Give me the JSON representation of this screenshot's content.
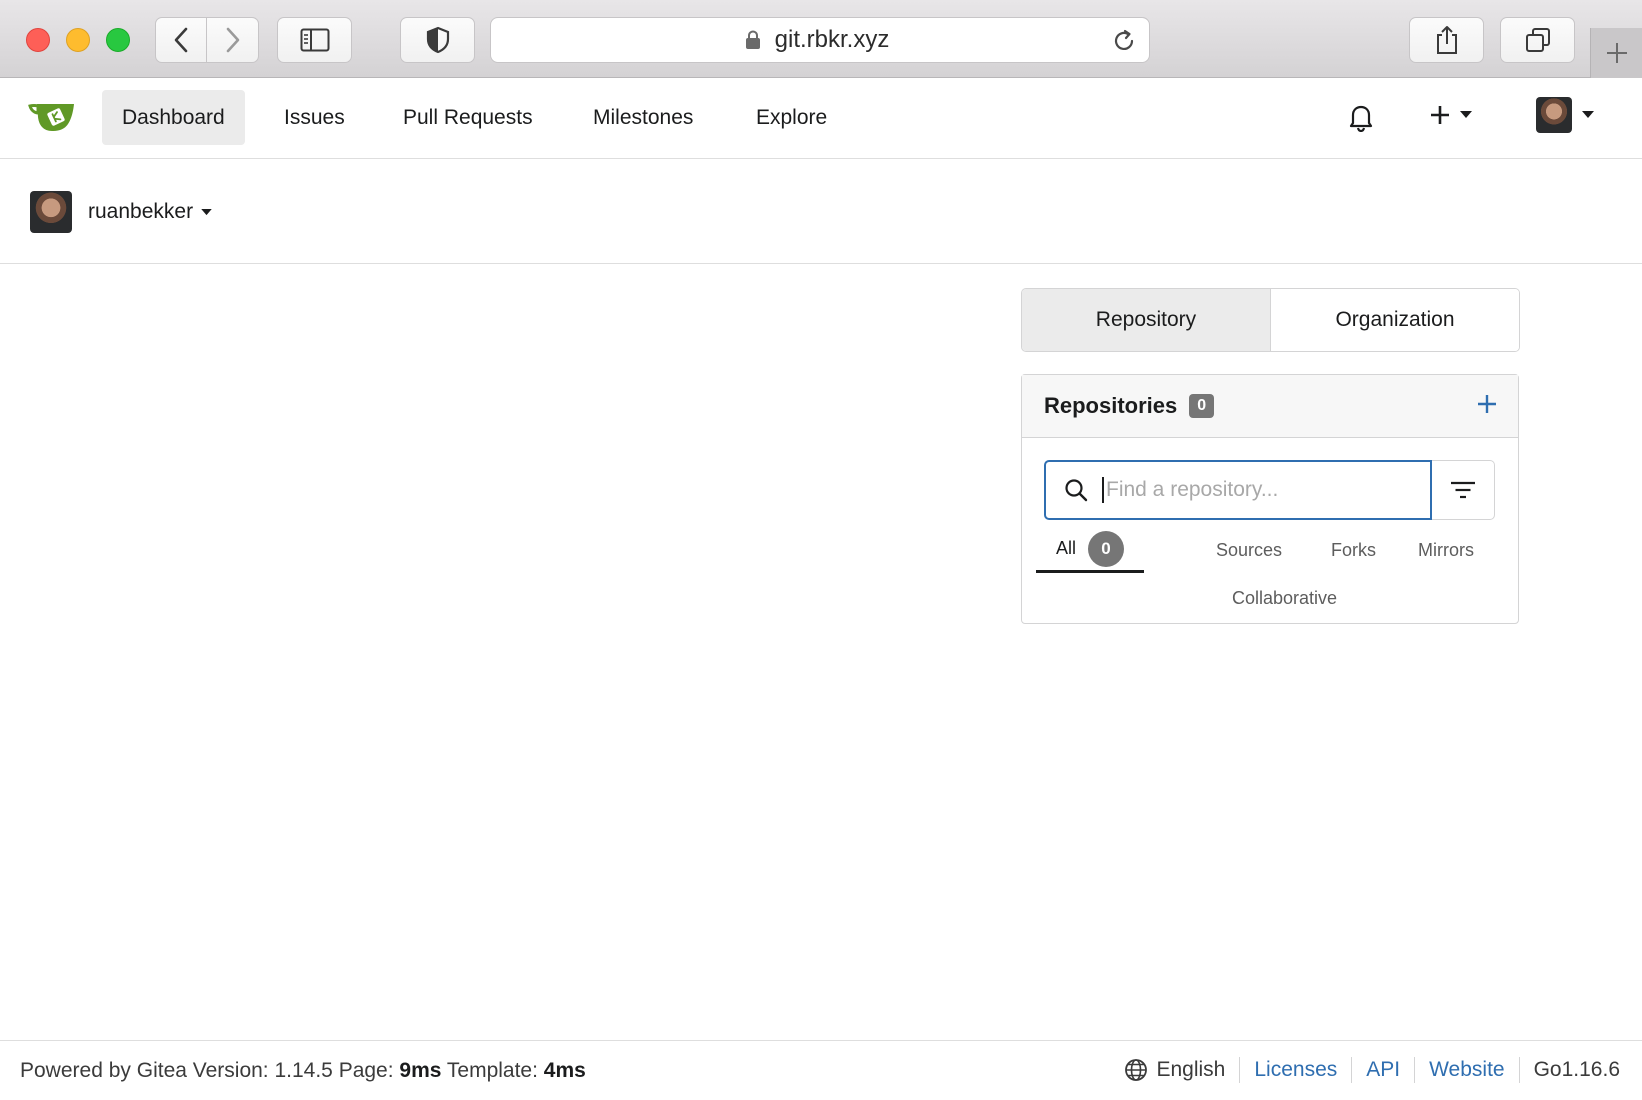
{
  "browser": {
    "url": "git.rbkr.xyz"
  },
  "nav": {
    "items": [
      {
        "label": "Dashboard"
      },
      {
        "label": "Issues"
      },
      {
        "label": "Pull Requests"
      },
      {
        "label": "Milestones"
      },
      {
        "label": "Explore"
      }
    ]
  },
  "context": {
    "username": "ruanbekker"
  },
  "switcher": {
    "repository": "Repository",
    "organization": "Organization"
  },
  "repos": {
    "title": "Repositories",
    "count": "0",
    "search_placeholder": "Find a repository...",
    "tabs": {
      "all": "All",
      "all_count": "0",
      "sources": "Sources",
      "forks": "Forks",
      "mirrors": "Mirrors",
      "collaborative": "Collaborative"
    }
  },
  "footer": {
    "powered": "Powered by Gitea Version: 1.14.5 Page: ",
    "page_time": "9ms",
    "template_label": " Template: ",
    "template_time": "4ms",
    "language": "English",
    "licenses": "Licenses",
    "api": "API",
    "website": "Website",
    "go_version": "Go1.16.6"
  },
  "colors": {
    "accent": "#2f6eb0",
    "gitea_green": "#609926",
    "badge_gray": "#767676"
  }
}
